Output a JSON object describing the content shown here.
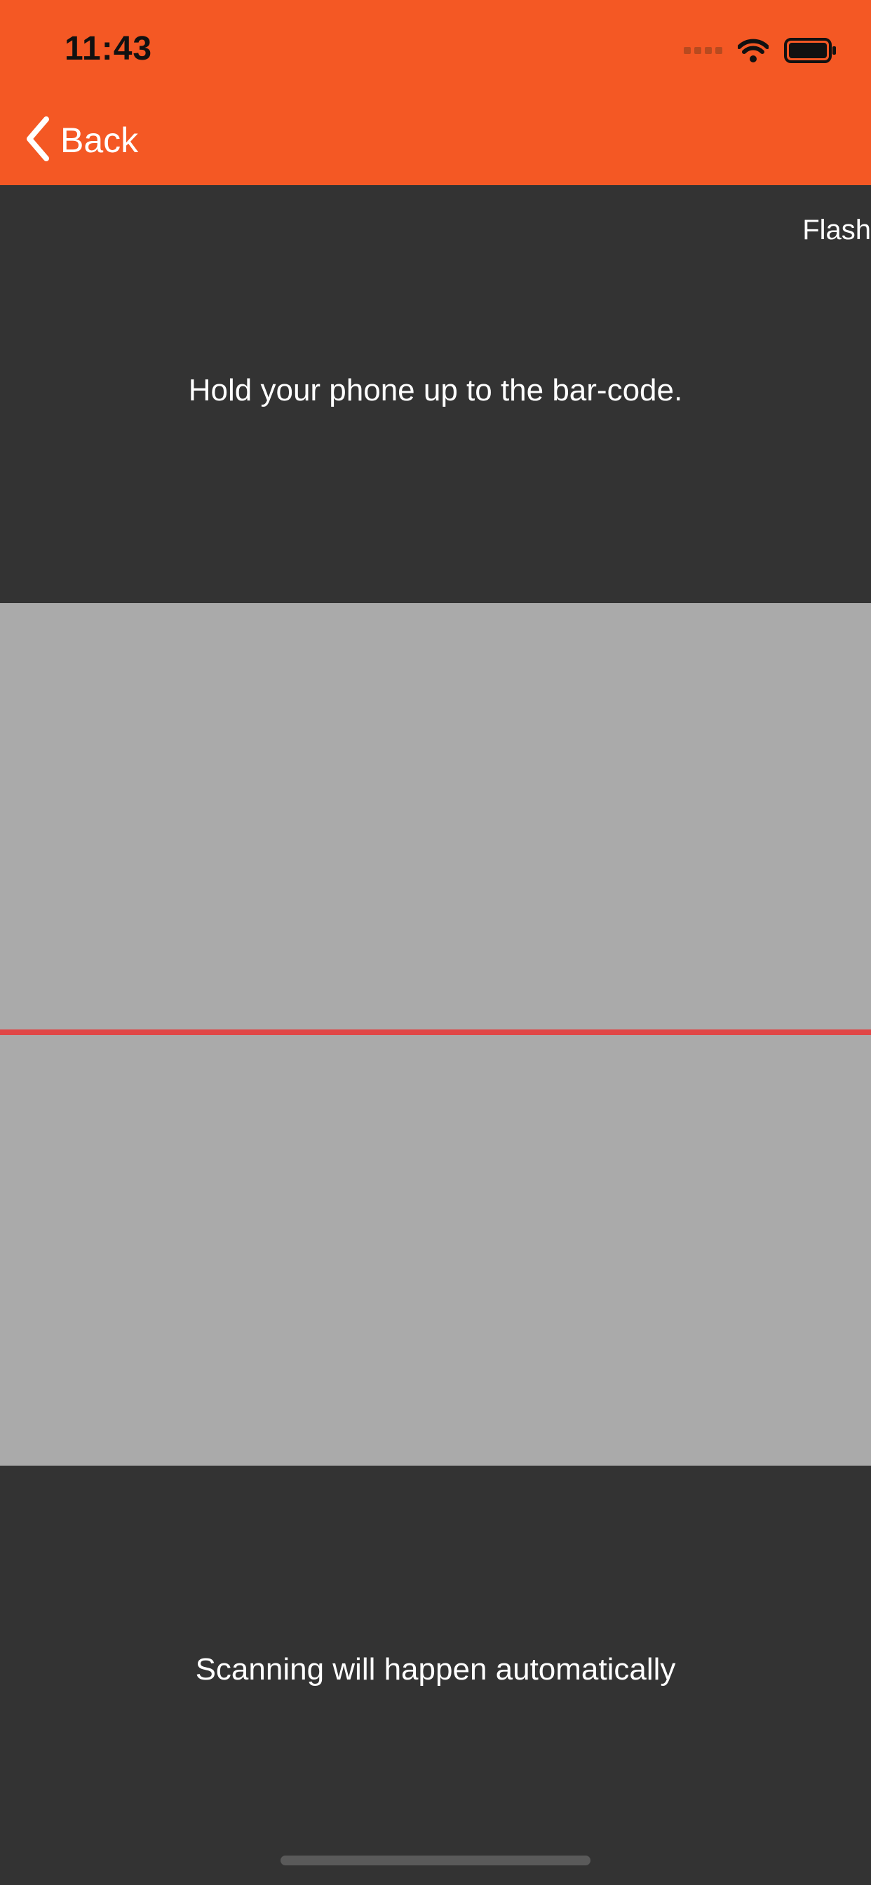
{
  "status_bar": {
    "time": "11:43",
    "icons": [
      "cellular-signal-icon",
      "wifi-icon",
      "battery-icon"
    ]
  },
  "nav": {
    "back_label": "Back",
    "back_icon": "chevron-left-icon"
  },
  "scanner": {
    "flash_label": "Flash",
    "instruction": "Hold your phone up to the bar-code.",
    "footer_text": "Scanning will happen automatically"
  },
  "colors": {
    "header": "#f45824",
    "background": "#333333",
    "scan_area": "#aaaaaa",
    "scan_line": "#e04646",
    "text": "#ffffff"
  }
}
